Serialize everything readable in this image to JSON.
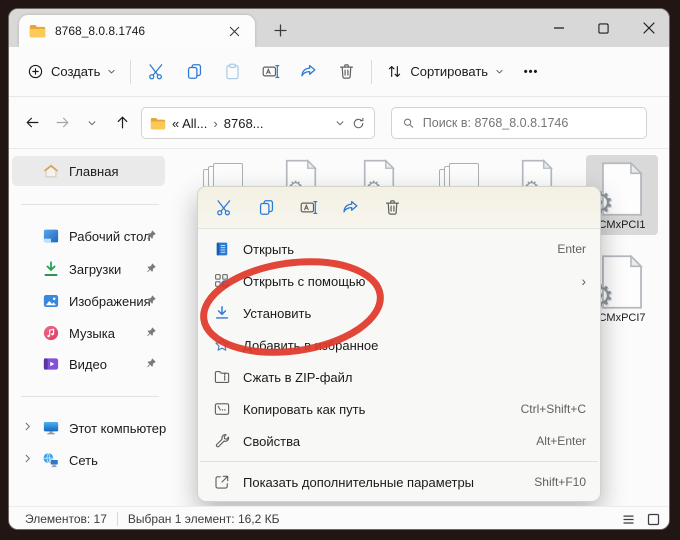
{
  "window": {
    "tab_title": "8768_8.0.8.1746"
  },
  "toolbar": {
    "new_label": "Создать",
    "sort_label": "Сортировать",
    "more_label": "•••"
  },
  "address_bar": {
    "breadcrumb": {
      "root": "« All...",
      "sep": "›",
      "current": "8768..."
    },
    "search_placeholder": "Поиск в: 8768_8.0.8.1746"
  },
  "sidebar": {
    "items": [
      {
        "label": "Главная",
        "icon": "home-icon",
        "selected": true
      },
      {
        "label": "Рабочий стол",
        "icon": "desktop-icon",
        "pinned": true
      },
      {
        "label": "Загрузки",
        "icon": "downloads-icon",
        "pinned": true
      },
      {
        "label": "Изображения",
        "icon": "pictures-icon",
        "pinned": true
      },
      {
        "label": "Музыка",
        "icon": "music-icon",
        "pinned": true
      },
      {
        "label": "Видео",
        "icon": "video-icon",
        "pinned": true
      },
      {
        "label": "Этот компьютер",
        "icon": "this-pc-icon",
        "expandable": true
      },
      {
        "label": "Сеть",
        "icon": "network-icon",
        "expandable": true
      }
    ]
  },
  "files": {
    "items": [
      {
        "label": "CMxPCI1",
        "selected": true
      },
      {
        "label": "CMxPCI7",
        "selected": false
      }
    ]
  },
  "context_menu": {
    "quick_actions": [
      "cut",
      "copy",
      "rename",
      "share",
      "delete"
    ],
    "submenu_glyph": "›",
    "items": [
      {
        "label": "Открыть",
        "shortcut": "Enter",
        "icon": "open-icon"
      },
      {
        "label": "Открыть с помощью",
        "shortcut": "",
        "icon": "open-with-icon",
        "submenu": true
      },
      {
        "label": "Установить",
        "shortcut": "",
        "icon": "install-icon",
        "annotated": true
      },
      {
        "label": "Добавить в избранное",
        "shortcut": "",
        "icon": "favorite-icon"
      },
      {
        "label": "Сжать в ZIP-файл",
        "shortcut": "",
        "icon": "zip-icon"
      },
      {
        "label": "Копировать как путь",
        "shortcut": "Ctrl+Shift+C",
        "icon": "copy-path-icon"
      },
      {
        "label": "Свойства",
        "shortcut": "Alt+Enter",
        "icon": "properties-icon"
      },
      {
        "label": "Показать дополнительные параметры",
        "shortcut": "Shift+F10",
        "icon": "more-options-icon",
        "separator_before": true
      }
    ]
  },
  "status_bar": {
    "items_count": "Элементов: 17",
    "selection_info": "Выбран 1 элемент: 16,2 КБ"
  },
  "glyphs": {
    "gear": "⚙"
  },
  "colors": {
    "accent": "#2a7ad4",
    "annotation_red": "#e0382a",
    "selection_gray": "#d9d9d9"
  }
}
